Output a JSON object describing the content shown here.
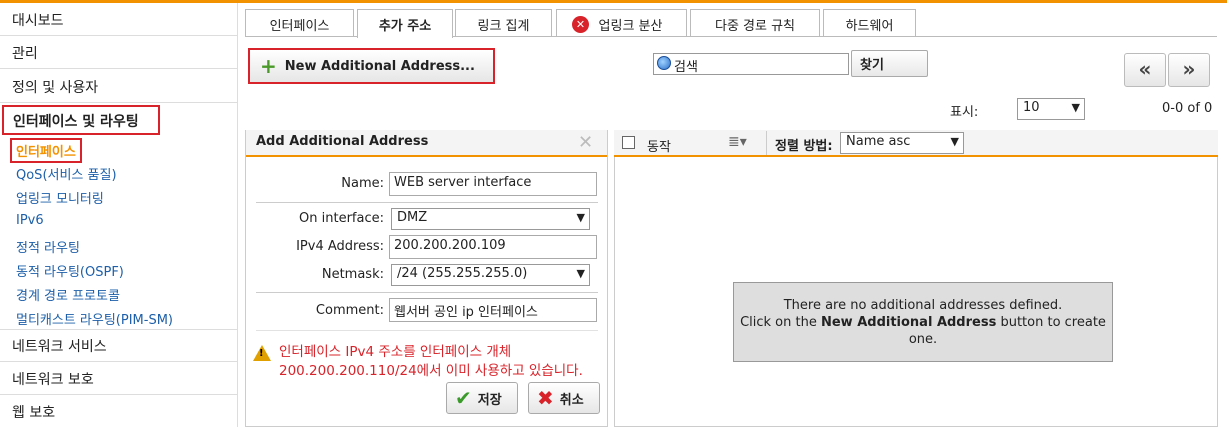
{
  "sidebar": {
    "sections": [
      "대시보드",
      "관리",
      "정의 및 사용자",
      "인터페이스 및 라우팅"
    ],
    "sub_items": [
      "인터페이스",
      "QoS(서비스 품질)",
      "업링크 모니터링",
      "IPv6",
      "정적 라우팅",
      "동적 라우팅(OSPF)",
      "경계 경로 프로토콜",
      "멀티캐스트 라우팅(PIM-SM)"
    ],
    "bottom_sections": [
      "네트워크 서비스",
      "네트워크 보호",
      "웹 보호"
    ]
  },
  "tabs": [
    "인터페이스",
    "추가 주소",
    "링크 집계",
    "업링크 분산",
    "다중 경로 규칙",
    "하드웨어"
  ],
  "toolbar": {
    "new_button": "New Additional Address...",
    "search_placeholder": "검색",
    "find_button": "찾기",
    "prev": "«",
    "next": "»",
    "display_label": "표시:",
    "display_value": "10",
    "count": "0-0 of 0"
  },
  "form": {
    "title": "Add Additional Address",
    "name_label": "Name:",
    "name_value": "WEB server interface",
    "interface_label": "On interface:",
    "interface_value": "DMZ",
    "ipv4_label": "IPv4 Address:",
    "ipv4_value": "200.200.200.109",
    "netmask_label": "Netmask:",
    "netmask_value": "/24 (255.255.255.0)",
    "comment_label": "Comment:",
    "comment_value": "웹서버 공인 ip 인터페이스",
    "warning_line1": "인터페이스 IPv4 주소를 인터페이스 개체",
    "warning_line2": "200.200.200.110/24에서 이미 사용하고 있습니다.",
    "save_button": "저장",
    "cancel_button": "취소"
  },
  "list": {
    "action_col": "동작",
    "sort_label": "정렬 방법:",
    "sort_value": "Name asc",
    "empty_line1": "There are no additional addresses defined.",
    "empty_line2_pre": "Click on the ",
    "empty_line2_bold": "New Additional Address",
    "empty_line2_post": " button to create",
    "empty_line3": "one."
  },
  "colors": {
    "accent": "#f39200",
    "highlight": "#d8232a",
    "link": "#1d5fa8"
  }
}
